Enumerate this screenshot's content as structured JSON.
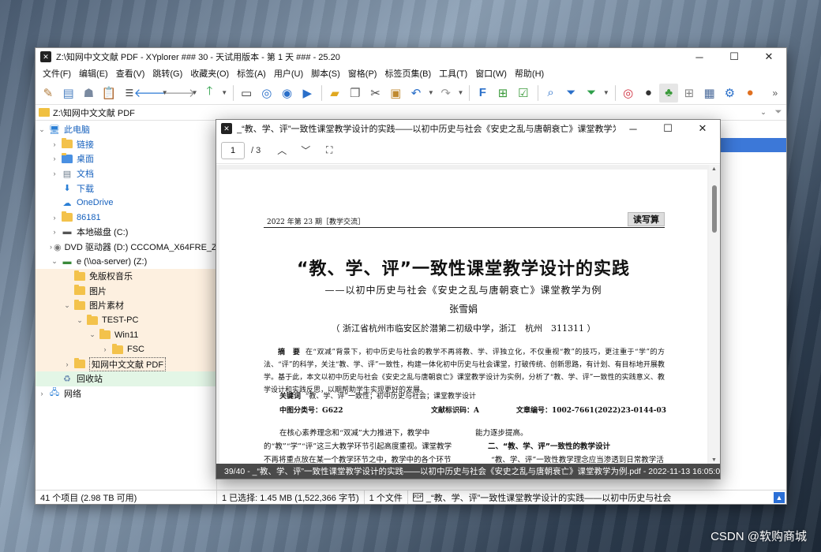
{
  "main_window": {
    "title": "Z:\\知网中文文献 PDF - XYplorer ### 30 - 天试用版本 - 第 1 天 ### - 25.20",
    "controls": {
      "minimize": "─",
      "maximize": "☐",
      "close": "✕"
    }
  },
  "menu": [
    "文件(F)",
    "编辑(E)",
    "查看(V)",
    "跳转(G)",
    "收藏夹(O)",
    "标签(A)",
    "用户(U)",
    "脚本(S)",
    "窗格(P)",
    "标签页集(B)",
    "工具(T)",
    "窗口(W)",
    "帮助(H)"
  ],
  "toolbar_icons": [
    "brush-icon",
    "panel-icon",
    "ghost-icon",
    "clipboard-icon",
    "list-icon",
    "back-icon",
    "forward-icon",
    "up-icon",
    "monitor-icon",
    "target-icon",
    "search-circle-icon",
    "play-circle-icon",
    "new-folder-icon",
    "copy-icon",
    "cut-icon",
    "paste-icon",
    "undo-icon",
    "redo-icon",
    "filter-f-icon",
    "tree-icon",
    "checkbox-icon",
    "find-icon",
    "funnel-icon",
    "funnel-green-icon",
    "spiral-icon",
    "moon-icon",
    "android-icon",
    "grid-icon",
    "calc-icon",
    "gear-icon",
    "ball-icon"
  ],
  "address": {
    "path": "Z:\\知网中文文献 PDF"
  },
  "tree": [
    {
      "label": "此电脑",
      "indent": 0,
      "exp": "⌄",
      "icon": "pc",
      "blue": true
    },
    {
      "label": "链接",
      "indent": 1,
      "exp": "›",
      "icon": "folder-link",
      "blue": true
    },
    {
      "label": "桌面",
      "indent": 1,
      "exp": "›",
      "icon": "desktop",
      "blue": true
    },
    {
      "label": "文档",
      "indent": 1,
      "exp": "›",
      "icon": "doc",
      "blue": true
    },
    {
      "label": "下载",
      "indent": 1,
      "exp": "",
      "icon": "download",
      "blue": true
    },
    {
      "label": "OneDrive",
      "indent": 1,
      "exp": "",
      "icon": "cloud",
      "blue": true
    },
    {
      "label": "86181",
      "indent": 1,
      "exp": "›",
      "icon": "folder",
      "blue": true
    },
    {
      "label": "本地磁盘 (C:)",
      "indent": 1,
      "exp": "›",
      "icon": "drive",
      "blue": false
    },
    {
      "label": "DVD 驱动器 (D:) CCCOMA_X64FRE_ZH-C",
      "indent": 1,
      "exp": "›",
      "icon": "dvd",
      "blue": false
    },
    {
      "label": "e (\\\\oa-server) (Z:)",
      "indent": 1,
      "exp": "⌄",
      "icon": "netdrive",
      "blue": false
    },
    {
      "label": "免版权音乐",
      "indent": 2,
      "exp": "",
      "icon": "folder",
      "blue": false,
      "hl": "peach"
    },
    {
      "label": "图片",
      "indent": 2,
      "exp": "",
      "icon": "folder",
      "blue": false,
      "hl": "peach"
    },
    {
      "label": "图片素材",
      "indent": 2,
      "exp": "⌄",
      "icon": "folder",
      "blue": false,
      "hl": "peach"
    },
    {
      "label": "TEST-PC",
      "indent": 3,
      "exp": "⌄",
      "icon": "folder",
      "blue": false,
      "hl": "peach"
    },
    {
      "label": "Win11",
      "indent": 4,
      "exp": "⌄",
      "icon": "folder",
      "blue": false,
      "hl": "peach"
    },
    {
      "label": "FSC",
      "indent": 5,
      "exp": "›",
      "icon": "folder",
      "blue": false,
      "hl": "peach"
    },
    {
      "label": "知网中文文献 PDF",
      "indent": 2,
      "exp": "›",
      "icon": "folder",
      "blue": false,
      "hl": "peach",
      "sel": true
    },
    {
      "label": "回收站",
      "indent": 1,
      "exp": "",
      "icon": "recycle",
      "blue": false,
      "hl": "green"
    },
    {
      "label": "网络",
      "indent": 0,
      "exp": "›",
      "icon": "network",
      "blue": false
    }
  ],
  "status": {
    "items": "41 个项目 (2.98 TB 可用)",
    "selected": "1 已选择: 1.45 MB (1,522,366 字节)",
    "files": "1 个文件",
    "filename": "_“教、学、评”一致性课堂教学设计的实践——以初中历史与社会"
  },
  "preview": {
    "title": "_“教、学、评”一致性课堂教学设计的实践——以初中历史与社会《安史之乱与唐朝衰亡》课堂教学为例.pdf",
    "page_current": "1",
    "page_total": "/ 3",
    "status": "39/40 - _“教、学、评”一致性课堂教学设计的实践——以初中历史与社会《安史之乱与唐朝衰亡》课堂教学为例.pdf - 2022-11-13 16:05:06",
    "doc": {
      "header_left": "2022 年第 23 期［教学交流］",
      "header_right": "读写算",
      "title": "“教、学、评”一致性课堂教学设计的实践",
      "subtitle": "——以初中历史与社会《安史之乱与唐朝衰亡》课堂教学为例",
      "author": "张雪娟",
      "affiliation": "（ 浙江省杭州市临安区於潜第二初级中学，浙江　杭州　311311 ）",
      "abstract_label": "摘　要",
      "abstract": "在“双减”背景下，初中历史与社会的教学不再将教、学、评独立化，不仅重视“教”的技巧，更注重于“学”的方法、“评”的科学，关注“教、学、评”一致性，构建一体化初中历史与社会课堂，打破传统、创新思路，有计划、有目标地开展教学。基于此，本文以初中历史与社会《安史之乱与唐朝衰亡》课堂教学设计为实例，分析了“教、学、评”一致性的实践意义、教学设计和实践反思，以期帮助学生实现更好的发展。",
      "keywords_label": "关键词",
      "keywords": "“教、学、评”一致性；初中历史与社会；课堂教学设计",
      "cls_label": "中图分类号：",
      "cls_value": "G622",
      "doc_id_label": "文献标识码：",
      "doc_id_value": "A",
      "article_no_label": "文章编号：",
      "article_no_value": "1002-7661(2022)23-0144-03",
      "left_col": "在核心素养理念和“双减”大力推进下，教学中的“教”“学”“评”这三大教学环节引起高度重视。课堂教学不再将重点放在某一个教学环节之中，教学中的各个环节不再孤立，而是注重“教、学、评”",
      "right_col_first": "能力逐步提高。",
      "right_heading": "二、“教、学、评”一致性的教学设计",
      "right_col": "“教、学、评”一致性教学理念应当渗透到日常教学活动中，与初中历史与社会课堂教学融为一体，将"
    }
  },
  "watermark": "CSDN @软购商城"
}
